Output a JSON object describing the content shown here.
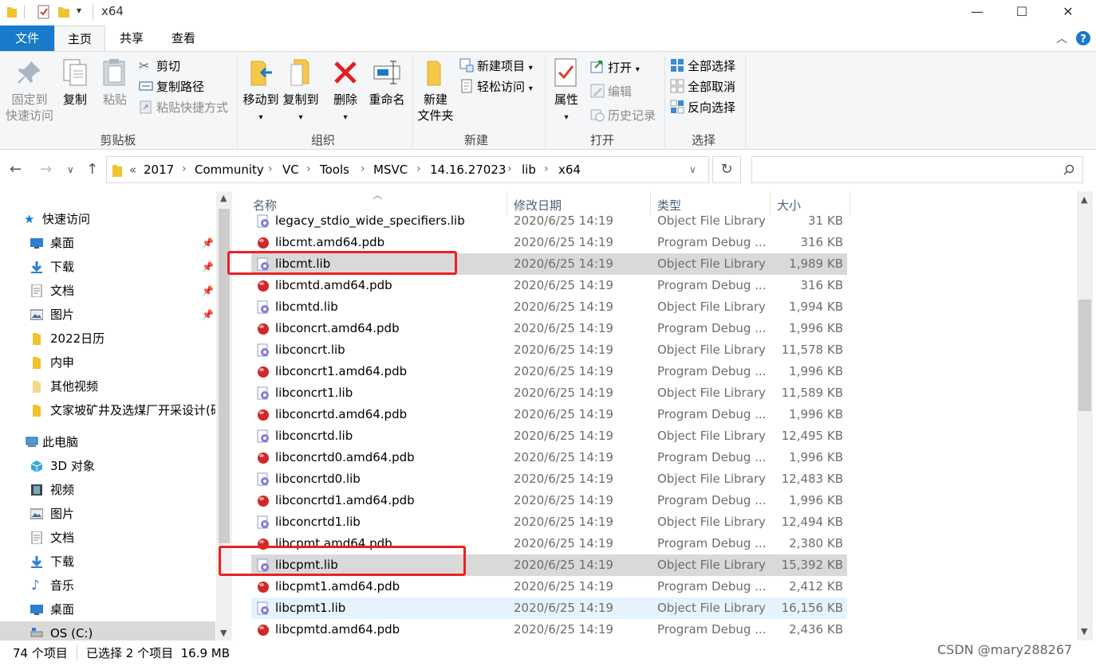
{
  "window": {
    "title": "x64",
    "minimize": "—",
    "maximize": "☐",
    "close": "✕"
  },
  "tabs": {
    "file": "文件",
    "home": "主页",
    "share": "共享",
    "view": "查看"
  },
  "ribbon": {
    "clipboard": {
      "label": "剪贴板",
      "pin_quick_access_1": "固定到",
      "pin_quick_access_2": "快速访问",
      "copy": "复制",
      "paste": "粘贴",
      "cut": "剪切",
      "copy_path": "复制路径",
      "paste_shortcut": "粘贴快捷方式"
    },
    "organize": {
      "label": "组织",
      "move_to": "移动到",
      "copy_to": "复制到",
      "delete": "删除",
      "rename": "重命名"
    },
    "new": {
      "label": "新建",
      "new_folder_1": "新建",
      "new_folder_2": "文件夹",
      "new_item": "新建项目",
      "easy_access": "轻松访问"
    },
    "open": {
      "label": "打开",
      "properties": "属性",
      "open": "打开",
      "edit": "编辑",
      "history": "历史记录"
    },
    "select": {
      "label": "选择",
      "select_all": "全部选择",
      "select_none": "全部取消",
      "invert": "反向选择"
    }
  },
  "address": {
    "overflow": "«",
    "crumbs": [
      "2017",
      "Community",
      "VC",
      "Tools",
      "MSVC",
      "14.16.27023",
      "lib",
      "x64"
    ],
    "search_placeholder": ""
  },
  "nav": {
    "quick_access": "快速访问",
    "items": [
      {
        "label": "桌面",
        "icon": "desktop-icon",
        "pinned": true
      },
      {
        "label": "下载",
        "icon": "download-icon",
        "pinned": true
      },
      {
        "label": "文档",
        "icon": "document-icon",
        "pinned": true
      },
      {
        "label": "图片",
        "icon": "picture-icon",
        "pinned": true
      },
      {
        "label": "2022日历",
        "icon": "folder-icon",
        "pinned": false
      },
      {
        "label": "内申",
        "icon": "folder-icon",
        "pinned": false
      },
      {
        "label": "其他视频",
        "icon": "folder-icon",
        "pinned": false
      },
      {
        "label": "文家坡矿井及选煤厂开采设计(硕",
        "icon": "folder-icon",
        "pinned": false
      }
    ],
    "this_pc": "此电脑",
    "pc_items": [
      {
        "label": "3D 对象",
        "icon": "3d-objects-icon"
      },
      {
        "label": "视频",
        "icon": "video-icon"
      },
      {
        "label": "图片",
        "icon": "picture-icon"
      },
      {
        "label": "文档",
        "icon": "document-icon"
      },
      {
        "label": "下载",
        "icon": "download-icon"
      },
      {
        "label": "音乐",
        "icon": "music-icon"
      },
      {
        "label": "桌面",
        "icon": "desktop-icon"
      },
      {
        "label": "OS (C:)",
        "icon": "drive-icon"
      }
    ]
  },
  "columns": {
    "name": "名称",
    "date": "修改日期",
    "type": "类型",
    "size": "大小"
  },
  "files": [
    {
      "name": "legacy_stdio_wide_specifiers.lib",
      "date": "2020/6/25 14:19",
      "type": "Object File Library",
      "size": "31 KB",
      "kind": "lib"
    },
    {
      "name": "libcmt.amd64.pdb",
      "date": "2020/6/25 14:19",
      "type": "Program Debug ...",
      "size": "316 KB",
      "kind": "pdb"
    },
    {
      "name": "libcmt.lib",
      "date": "2020/6/25 14:19",
      "type": "Object File Library",
      "size": "1,989 KB",
      "kind": "lib",
      "state": "sel"
    },
    {
      "name": "libcmtd.amd64.pdb",
      "date": "2020/6/25 14:19",
      "type": "Program Debug ...",
      "size": "316 KB",
      "kind": "pdb"
    },
    {
      "name": "libcmtd.lib",
      "date": "2020/6/25 14:19",
      "type": "Object File Library",
      "size": "1,994 KB",
      "kind": "lib"
    },
    {
      "name": "libconcrt.amd64.pdb",
      "date": "2020/6/25 14:19",
      "type": "Program Debug ...",
      "size": "1,996 KB",
      "kind": "pdb"
    },
    {
      "name": "libconcrt.lib",
      "date": "2020/6/25 14:19",
      "type": "Object File Library",
      "size": "11,578 KB",
      "kind": "lib"
    },
    {
      "name": "libconcrt1.amd64.pdb",
      "date": "2020/6/25 14:19",
      "type": "Program Debug ...",
      "size": "1,996 KB",
      "kind": "pdb"
    },
    {
      "name": "libconcrt1.lib",
      "date": "2020/6/25 14:19",
      "type": "Object File Library",
      "size": "11,589 KB",
      "kind": "lib"
    },
    {
      "name": "libconcrtd.amd64.pdb",
      "date": "2020/6/25 14:19",
      "type": "Program Debug ...",
      "size": "1,996 KB",
      "kind": "pdb"
    },
    {
      "name": "libconcrtd.lib",
      "date": "2020/6/25 14:19",
      "type": "Object File Library",
      "size": "12,495 KB",
      "kind": "lib"
    },
    {
      "name": "libconcrtd0.amd64.pdb",
      "date": "2020/6/25 14:19",
      "type": "Program Debug ...",
      "size": "1,996 KB",
      "kind": "pdb"
    },
    {
      "name": "libconcrtd0.lib",
      "date": "2020/6/25 14:19",
      "type": "Object File Library",
      "size": "12,483 KB",
      "kind": "lib"
    },
    {
      "name": "libconcrtd1.amd64.pdb",
      "date": "2020/6/25 14:19",
      "type": "Program Debug ...",
      "size": "1,996 KB",
      "kind": "pdb"
    },
    {
      "name": "libconcrtd1.lib",
      "date": "2020/6/25 14:19",
      "type": "Object File Library",
      "size": "12,494 KB",
      "kind": "lib"
    },
    {
      "name": "libcpmt.amd64.pdb",
      "date": "2020/6/25 14:19",
      "type": "Program Debug ...",
      "size": "2,380 KB",
      "kind": "pdb"
    },
    {
      "name": "libcpmt.lib",
      "date": "2020/6/25 14:19",
      "type": "Object File Library",
      "size": "15,392 KB",
      "kind": "lib",
      "state": "sel"
    },
    {
      "name": "libcpmt1.amd64.pdb",
      "date": "2020/6/25 14:19",
      "type": "Program Debug ...",
      "size": "2,412 KB",
      "kind": "pdb"
    },
    {
      "name": "libcpmt1.lib",
      "date": "2020/6/25 14:19",
      "type": "Object File Library",
      "size": "16,156 KB",
      "kind": "lib",
      "state": "hov"
    },
    {
      "name": "libcpmtd.amd64.pdb",
      "date": "2020/6/25 14:19",
      "type": "Program Debug ...",
      "size": "2,436 KB",
      "kind": "pdb"
    }
  ],
  "status": {
    "count": "74 个项目",
    "selection": "已选择 2 个项目  16.9 MB"
  },
  "watermark": "CSDN @mary288267",
  "colors": {
    "accent": "#1979ca",
    "selection": "#d9d9d9",
    "hover": "#e5f3ff",
    "annotation": "#ee2020"
  }
}
